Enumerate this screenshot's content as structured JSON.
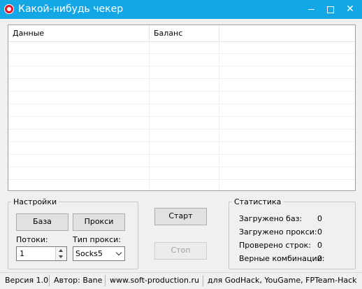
{
  "window": {
    "title": "Какой-нибудь чекер"
  },
  "grid": {
    "columns": [
      "Данные",
      "Баланс"
    ]
  },
  "settings": {
    "legend": "Настройки",
    "db_button": "База",
    "proxy_button": "Прокси",
    "threads_label": "Потоки:",
    "threads_value": "1",
    "proxy_type_label": "Тип прокси:",
    "proxy_type_value": "Socks5"
  },
  "actions": {
    "start": "Старт",
    "stop": "Стоп"
  },
  "stats": {
    "legend": "Статистика",
    "items": [
      {
        "label": "Загружено баз:",
        "value": "0"
      },
      {
        "label": "Загружено прокси:",
        "value": "0"
      },
      {
        "label": "Проверено строк:",
        "value": "0"
      },
      {
        "label": "Верные комбинации:",
        "value": "0"
      }
    ]
  },
  "status": {
    "version": "Версия 1.0",
    "author": "Автор: Bane",
    "site": "www.soft-production.ru",
    "for": "для GodHack, YouGame, FPTeam-Hack"
  },
  "colors": {
    "titlebar": "#14a7e6",
    "app_icon": "#e81123"
  }
}
